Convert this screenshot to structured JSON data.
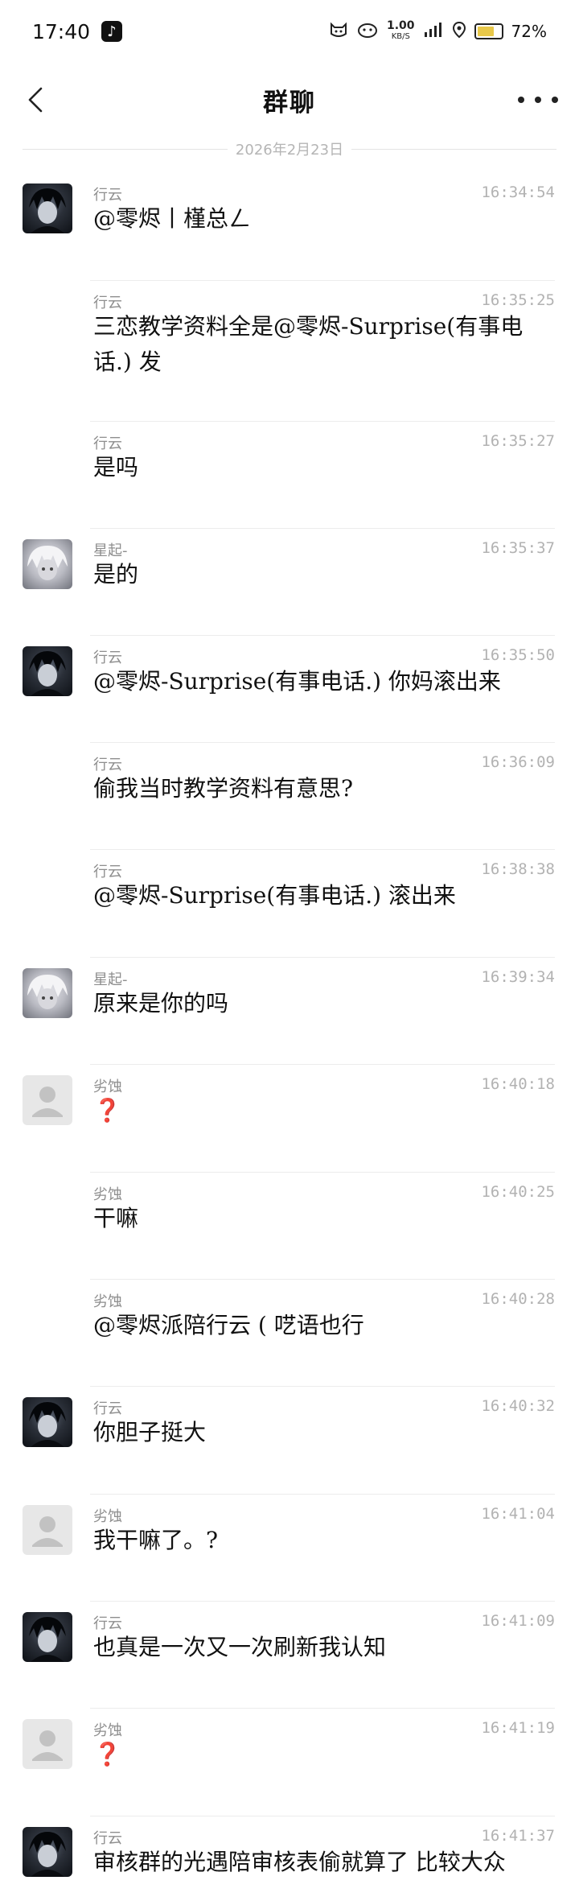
{
  "status_bar": {
    "time": "17:40",
    "app_icon": "tiktok-icon",
    "speed_value": "1.00",
    "speed_unit": "KB/S",
    "battery_percent": "72%",
    "battery_level": 0.72,
    "battery_color": "#e8c84a"
  },
  "header": {
    "title": "群聊",
    "back_icon": "chevron-left-icon",
    "more_icon": "more-dots-icon"
  },
  "date_divider": "2026年2月23日",
  "messages": [
    {
      "sender": "行云",
      "time": "16:34:54",
      "text": "@零烬丨槿总ㄥ",
      "avatar": "dark"
    },
    {
      "sender": "行云",
      "time": "16:35:25",
      "text": "三恋教学资料全是@零烬-Surprise(有事电话.) 发",
      "avatar": ""
    },
    {
      "sender": "行云",
      "time": "16:35:27",
      "text": "是吗",
      "avatar": ""
    },
    {
      "sender": "星起-",
      "time": "16:35:37",
      "text": "是的",
      "avatar": "light"
    },
    {
      "sender": "行云",
      "time": "16:35:50",
      "text": "@零烬-Surprise(有事电话.) 你妈滚出来",
      "avatar": "dark"
    },
    {
      "sender": "行云",
      "time": "16:36:09",
      "text": "偷我当时教学资料有意思?",
      "avatar": ""
    },
    {
      "sender": "行云",
      "time": "16:38:38",
      "text": "@零烬-Surprise(有事电话.) 滚出来",
      "avatar": ""
    },
    {
      "sender": "星起-",
      "time": "16:39:34",
      "text": "原来是你的吗",
      "avatar": "light"
    },
    {
      "sender": "劣蚀",
      "time": "16:40:18",
      "text": "❓",
      "avatar": "default"
    },
    {
      "sender": "劣蚀",
      "time": "16:40:25",
      "text": "干嘛",
      "avatar": ""
    },
    {
      "sender": "劣蚀",
      "time": "16:40:28",
      "text": "@零烬派陪行云 ( 呓语也行",
      "avatar": ""
    },
    {
      "sender": "行云",
      "time": "16:40:32",
      "text": "你胆子挺大",
      "avatar": "dark"
    },
    {
      "sender": "劣蚀",
      "time": "16:41:04",
      "text": "我干嘛了。?",
      "avatar": "default"
    },
    {
      "sender": "行云",
      "time": "16:41:09",
      "text": "也真是一次又一次刷新我认知",
      "avatar": "dark"
    },
    {
      "sender": "劣蚀",
      "time": "16:41:19",
      "text": "❓",
      "avatar": "default"
    },
    {
      "sender": "行云",
      "time": "16:41:37",
      "text": "审核群的光遇陪审核表偷就算了 比较大众",
      "avatar": "dark"
    }
  ]
}
